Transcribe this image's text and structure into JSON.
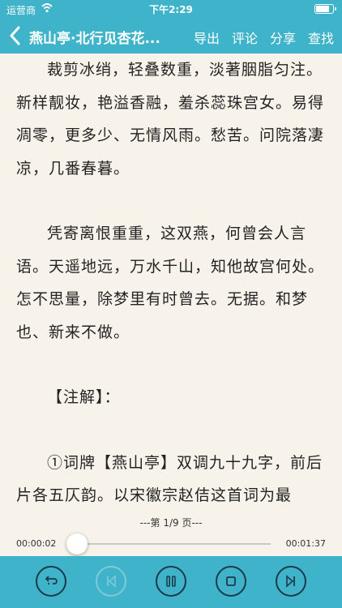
{
  "status": {
    "carrier": "运营商",
    "time": "下午2:29",
    "battery_level": 0.9
  },
  "nav": {
    "title": "燕山亭·北行见杏花...",
    "actions": [
      "导出",
      "评论",
      "分享",
      "查找"
    ]
  },
  "content": {
    "paragraphs": [
      "裁剪冰绡，轻叠数重，淡著胭脂匀注。新样靓妆，艳溢香融，羞杀蕊珠宫女。易得凋零，更多少、无情风雨。愁苦。问院落凄凉，几番春暮。",
      "凭寄离恨重重，这双燕，何曾会人言语。天遥地远，万水千山，知他故宫何处。怎不思量，除梦里有时曾去。无据。和梦也、新来不做。"
    ],
    "note_heading": "【注解】：",
    "note_text": "①词牌【燕山亭】双调九十九字，前后片各五仄韵。以宋徽宗赵佶这首词为最"
  },
  "player": {
    "page_label": "---第 1/9 页---",
    "elapsed": "00:00:02",
    "duration": "00:01:37",
    "progress": 0.02
  },
  "colors": {
    "accent": "#3fb3c9",
    "icon": "#1b3a4a",
    "disabled": "#7fc9d8",
    "background": "#f7f3ea"
  },
  "controls": [
    "repeat-icon",
    "previous-icon",
    "pause-icon",
    "stop-icon",
    "next-icon"
  ]
}
